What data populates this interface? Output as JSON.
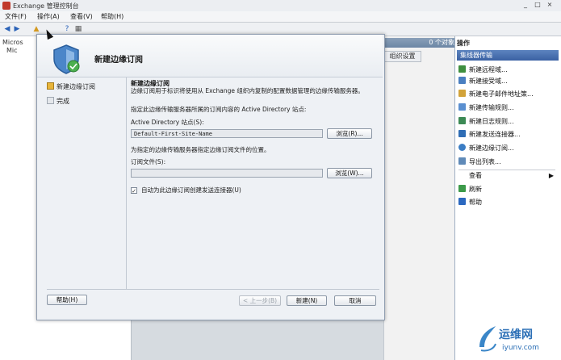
{
  "window": {
    "title": "Exchange 管理控制台",
    "controls": [
      "_",
      "□",
      "×"
    ]
  },
  "menu": [
    "文件(F)",
    "操作(A)",
    "查看(V)",
    "帮助(H)"
  ],
  "tree": {
    "root_label": "Micros",
    "node2_label": "Mic"
  },
  "center": {
    "count_label": "0 个对象",
    "tab_label": "组织设置"
  },
  "actions": {
    "header": "操作",
    "section": "集线器传输",
    "items": [
      "新建远程域...",
      "新建接受域...",
      "新建电子邮件地址策...",
      "新建传输规则...",
      "新建日志规则...",
      "新建发送连接器...",
      "新建边缘订阅...",
      "导出列表...",
      "查看",
      "刷新",
      "帮助"
    ],
    "colors": [
      "#3f8f3f",
      "#4a7fc1",
      "#d2a33a",
      "#5a8fd0",
      "#3c8a55",
      "#2f6db5",
      "#3b7dc4",
      "#5f8ab8",
      "#ffffff",
      "#3c9a4a",
      "#2b68c0"
    ]
  },
  "dialog": {
    "title": "新建边缘订阅",
    "steps": [
      "新建边缘订阅",
      "完成"
    ],
    "section_title": "新建边缘订阅",
    "desc": "边缘订阅用于标识将使用从 Exchange 组织内复制的配置数据管理的边缘传输服务器。",
    "site_instruction": "指定此边缘传输服务器所属的订阅内容的 Active Directory 站点:",
    "site_label": "Active Directory 站点(S):",
    "site_value": "Default-First-Site-Name",
    "browse1": "浏览(R)...",
    "file_instruction": "为指定的边缘传输服务器指定边缘订阅文件的位置。",
    "file_label": "订阅文件(S):",
    "file_value": "",
    "browse2": "浏览(W)...",
    "checkbox_label": "自动为此边缘订阅创建发送连接器(U)",
    "checkbox_checked": true,
    "checkbox_mark": "✓",
    "help_btn": "帮助(H)",
    "back_btn": "< 上一步(B)",
    "new_btn": "新建(N)",
    "cancel_btn": "取消"
  },
  "watermark": {
    "text": "运维网",
    "url": "iyunv.com"
  }
}
